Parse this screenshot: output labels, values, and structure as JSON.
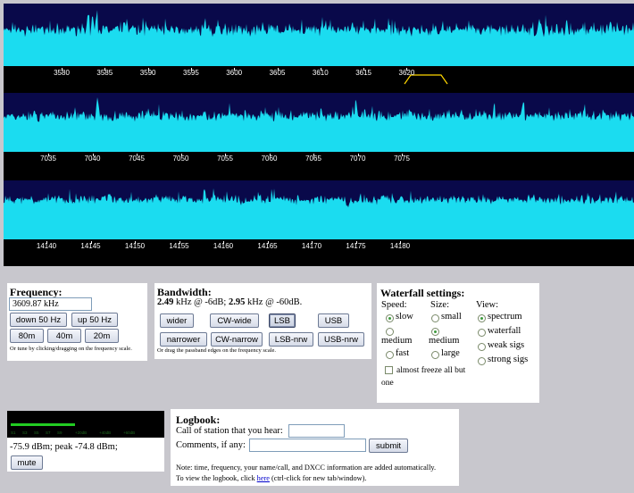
{
  "bands": [
    {
      "labels": [
        "3580",
        "3585",
        "3590",
        "3595",
        "3600",
        "3605",
        "3610",
        "3615",
        "3620"
      ]
    },
    {
      "labels": [
        "7035",
        "7040",
        "7045",
        "7050",
        "7055",
        "7060",
        "7065",
        "7070",
        "7075"
      ]
    },
    {
      "labels": [
        "14140",
        "14145",
        "14150",
        "14155",
        "14160",
        "14165",
        "14170",
        "14175",
        "14180"
      ]
    }
  ],
  "colors": {
    "background": "#c8c7cd",
    "spectrum_fill": "#1bdcf0",
    "spectrum_bg": "#09094a",
    "scale_bg": "#000000",
    "passband": "#ffd700",
    "smeter_bar": "#22cc22"
  },
  "frequency": {
    "title": "Frequency:",
    "value": "3609.87 kHz",
    "buttons": {
      "down": "down 50 Hz",
      "up": "up 50 Hz",
      "b80": "80m",
      "b40": "40m",
      "b20": "20m"
    },
    "hint": "Or tune by clicking/dragging on the frequency scale."
  },
  "bandwidth": {
    "title": "Bandwidth:",
    "v6": "2.49",
    "at6": " kHz @ -6dB; ",
    "v60": "2.95",
    "at60": " kHz @ -60dB.",
    "buttons": {
      "wider": "wider",
      "cwwide": "CW-wide",
      "lsb": "LSB",
      "usb": "USB",
      "narrower": "narrower",
      "cwnarrow": "CW-narrow",
      "lsbnrw": "LSB-nrw",
      "usbnrw": "USB-nrw"
    },
    "hint": "Or drag the passband edges on the frequency scale."
  },
  "waterfall": {
    "title": "Waterfall settings:",
    "speed_label": "Speed:",
    "size_label": "Size:",
    "view_label": "View:",
    "speed": [
      "slow",
      "medium",
      "fast"
    ],
    "speed_selected": "slow",
    "size": [
      "small",
      "medium",
      "large"
    ],
    "size_selected": "medium",
    "view": [
      "spectrum",
      "waterfall",
      "weak sigs",
      "strong sigs"
    ],
    "view_selected": "spectrum",
    "freeze_l1": "almost freeze all but",
    "freeze_l2": "one"
  },
  "smeter": {
    "reading": "-75.9 dBm; peak -74.8 dBm;",
    "mute": "mute",
    "scale": [
      "S1",
      "S3",
      "S5",
      "S7",
      "S9",
      "+20dB",
      "+40dB",
      "+60dB"
    ]
  },
  "logbook": {
    "title": "Logbook:",
    "call_label": "Call of station that you hear:",
    "comments_label": "Comments, if any:",
    "submit": "submit",
    "note1": "Note: time, frequency, your name/call, and DXCC information are added automatically.",
    "note2_pre": "To view the logbook, click ",
    "note2_link": "here",
    "note2_post": " (ctrl-click for new tab/window)."
  }
}
